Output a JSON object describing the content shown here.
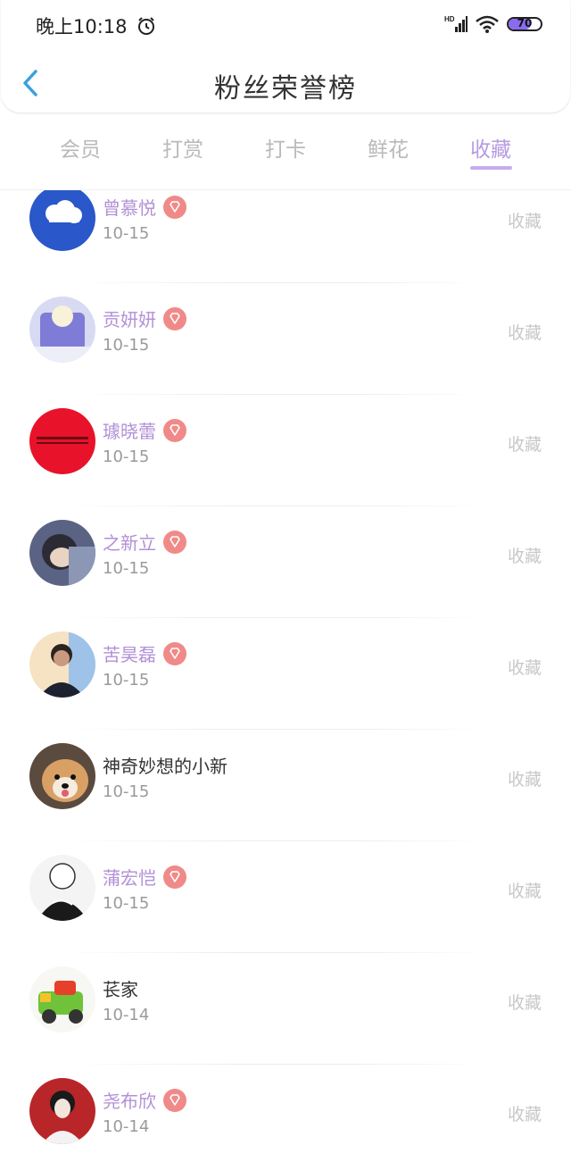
{
  "status": {
    "time": "晚上10:18",
    "network": "HD",
    "battery": "70",
    "battery_level": 0.7
  },
  "header": {
    "title": "粉丝荣誉榜"
  },
  "tabs": [
    {
      "label": "会员"
    },
    {
      "label": "打赏"
    },
    {
      "label": "打卡"
    },
    {
      "label": "鲜花"
    },
    {
      "label": "收藏"
    }
  ],
  "active_tab": "收藏",
  "colors": {
    "vip_name": "#b290d6",
    "vip_badge": "#f08a88",
    "tab_active": "#b79be0"
  },
  "fans": [
    {
      "name": "曾慕悦",
      "date": "10-15",
      "action": "收藏",
      "vip": true,
      "avatar": "cloud-avatar"
    },
    {
      "name": "贡妍妍",
      "date": "10-15",
      "action": "收藏",
      "vip": true,
      "avatar": "cartoon-avatar"
    },
    {
      "name": "璩晓蕾",
      "date": "10-15",
      "action": "收藏",
      "vip": true,
      "avatar": "red-banner-avatar"
    },
    {
      "name": "之新立",
      "date": "10-15",
      "action": "收藏",
      "vip": true,
      "avatar": "anime-avatar"
    },
    {
      "name": "苦昊磊",
      "date": "10-15",
      "action": "收藏",
      "vip": true,
      "avatar": "singer-avatar"
    },
    {
      "name": "神奇妙想的小新",
      "date": "10-15",
      "action": "收藏",
      "vip": false,
      "avatar": "dog-avatar"
    },
    {
      "name": "蒲宏恺",
      "date": "10-15",
      "action": "收藏",
      "vip": true,
      "avatar": "sketch-avatar"
    },
    {
      "name": "苌家",
      "date": "10-14",
      "action": "收藏",
      "vip": false,
      "avatar": "toy-truck-avatar"
    },
    {
      "name": "尧布欣",
      "date": "10-14",
      "action": "收藏",
      "vip": true,
      "avatar": "girl-avatar"
    }
  ]
}
